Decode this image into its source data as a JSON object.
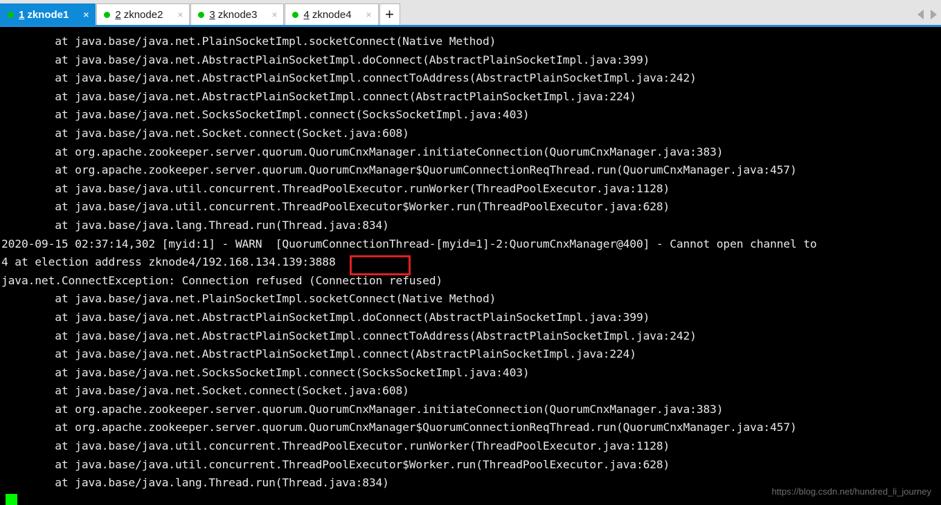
{
  "tabbar": {
    "tabs": [
      {
        "num": "1",
        "label": "zknode1",
        "close": "×",
        "active": true,
        "status_color": "#00c400"
      },
      {
        "num": "2",
        "label": "zknode2",
        "close": "×",
        "active": false,
        "status_color": "#00c400"
      },
      {
        "num": "3",
        "label": "zknode3",
        "close": "×",
        "active": false,
        "status_color": "#00c400"
      },
      {
        "num": "4",
        "label": "zknode4",
        "close": "×",
        "active": false,
        "status_color": "#00c400"
      }
    ],
    "new_tab_label": "+",
    "scroll_left_icon": "chevron-left-icon",
    "scroll_right_icon": "chevron-right-icon",
    "active_tab_color": "#0f8ad8",
    "bar_background": "#e4e4e4",
    "accent_underline": "#1a8cd8"
  },
  "terminal": {
    "background": "#000000",
    "foreground": "#e8e8e8",
    "cursor_color": "#00f900",
    "highlight_color": "#e02020",
    "highlighted_text": "3888",
    "lines": [
      "        at java.base/java.net.PlainSocketImpl.socketConnect(Native Method)",
      "        at java.base/java.net.AbstractPlainSocketImpl.doConnect(AbstractPlainSocketImpl.java:399)",
      "        at java.base/java.net.AbstractPlainSocketImpl.connectToAddress(AbstractPlainSocketImpl.java:242)",
      "        at java.base/java.net.AbstractPlainSocketImpl.connect(AbstractPlainSocketImpl.java:224)",
      "        at java.base/java.net.SocksSocketImpl.connect(SocksSocketImpl.java:403)",
      "        at java.base/java.net.Socket.connect(Socket.java:608)",
      "        at org.apache.zookeeper.server.quorum.QuorumCnxManager.initiateConnection(QuorumCnxManager.java:383)",
      "        at org.apache.zookeeper.server.quorum.QuorumCnxManager$QuorumConnectionReqThread.run(QuorumCnxManager.java:457)",
      "        at java.base/java.util.concurrent.ThreadPoolExecutor.runWorker(ThreadPoolExecutor.java:1128)",
      "        at java.base/java.util.concurrent.ThreadPoolExecutor$Worker.run(ThreadPoolExecutor.java:628)",
      "        at java.base/java.lang.Thread.run(Thread.java:834)",
      "2020-09-15 02:37:14,302 [myid:1] - WARN  [QuorumConnectionThread-[myid=1]-2:QuorumCnxManager@400] - Cannot open channel to",
      "4 at election address zknode4/192.168.134.139:3888",
      "java.net.ConnectException: Connection refused (Connection refused)",
      "        at java.base/java.net.PlainSocketImpl.socketConnect(Native Method)",
      "        at java.base/java.net.AbstractPlainSocketImpl.doConnect(AbstractPlainSocketImpl.java:399)",
      "        at java.base/java.net.AbstractPlainSocketImpl.connectToAddress(AbstractPlainSocketImpl.java:242)",
      "        at java.base/java.net.AbstractPlainSocketImpl.connect(AbstractPlainSocketImpl.java:224)",
      "        at java.base/java.net.SocksSocketImpl.connect(SocksSocketImpl.java:403)",
      "        at java.base/java.net.Socket.connect(Socket.java:608)",
      "        at org.apache.zookeeper.server.quorum.QuorumCnxManager.initiateConnection(QuorumCnxManager.java:383)",
      "        at org.apache.zookeeper.server.quorum.QuorumCnxManager$QuorumConnectionReqThread.run(QuorumCnxManager.java:457)",
      "        at java.base/java.util.concurrent.ThreadPoolExecutor.runWorker(ThreadPoolExecutor.java:1128)",
      "        at java.base/java.util.concurrent.ThreadPoolExecutor$Worker.run(ThreadPoolExecutor.java:628)",
      "        at java.base/java.lang.Thread.run(Thread.java:834)"
    ]
  },
  "watermark": {
    "text": "https://blog.csdn.net/hundred_li_journey"
  }
}
